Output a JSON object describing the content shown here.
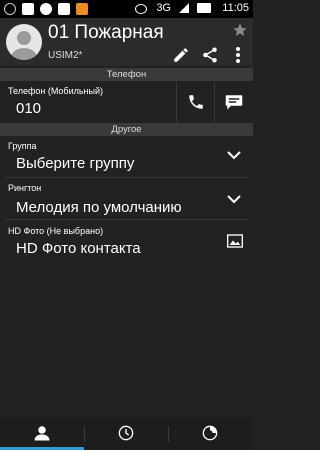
{
  "status_bar": {
    "network": "3G",
    "battery_percent": 100,
    "time": "11:05",
    "notification_icons": [
      "sync-icon",
      "image-icon",
      "navigation-icon",
      "app-86-icon",
      "orange-app-icon"
    ]
  },
  "header": {
    "contact_name": "01 Пожарная",
    "account": "USIM2*"
  },
  "sections": {
    "phone_header": "Телефон",
    "other_header": "Другое"
  },
  "phone": {
    "label": "Телефон  (Мобильный)",
    "value": "010"
  },
  "group": {
    "label": "Группа",
    "value": "Выберите группу"
  },
  "ringtone": {
    "label": "Рингтон",
    "value": "Мелодия по умолчанию"
  },
  "photo": {
    "label": "HD Фото (Не выбрано)",
    "value": "HD Фото контакта"
  },
  "colors": {
    "background": "#222222",
    "accent": "#2f9fd0",
    "section_bg": "#3a3a3a"
  }
}
